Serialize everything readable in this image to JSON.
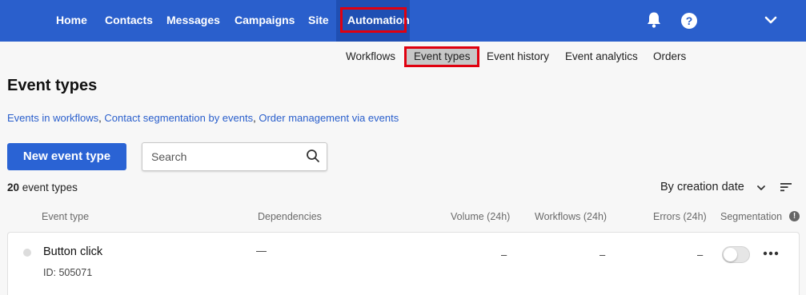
{
  "topnav": {
    "items": [
      {
        "label": "Home"
      },
      {
        "label": "Contacts"
      },
      {
        "label": "Messages"
      },
      {
        "label": "Campaigns"
      },
      {
        "label": "Site"
      },
      {
        "label": "Automation"
      }
    ],
    "active": "Automation",
    "icons": [
      "bell-icon",
      "help-icon",
      "chevron-down-icon"
    ],
    "help_glyph": "?"
  },
  "subnav": {
    "items": [
      {
        "label": "Workflows"
      },
      {
        "label": "Event types"
      },
      {
        "label": "Event history"
      },
      {
        "label": "Event analytics"
      },
      {
        "label": "Orders"
      }
    ],
    "active": "Event types"
  },
  "page": {
    "title": "Event types",
    "links": [
      "Events in workflows",
      "Contact segmentation by events",
      "Order management via events"
    ],
    "link_separator": ", "
  },
  "toolbar": {
    "new_button_label": "New event type",
    "search_placeholder": "Search"
  },
  "summary": {
    "count": "20",
    "count_suffix": " event types",
    "sort_label": "By creation date"
  },
  "table": {
    "columns": [
      "Event type",
      "Dependencies",
      "Volume (24h)",
      "Workflows (24h)",
      "Errors (24h)",
      "Segmentation"
    ],
    "info_glyph": "!",
    "rows": [
      {
        "name": "Button click",
        "id": "ID: 505071",
        "dependencies": "—",
        "volume": "–",
        "workflows": "–",
        "errors": "–",
        "segmentation_enabled": false
      }
    ]
  },
  "colors": {
    "brand_blue": "#2a5fcc",
    "highlight_red": "#e0000f",
    "link_blue": "#2a5fcc"
  }
}
